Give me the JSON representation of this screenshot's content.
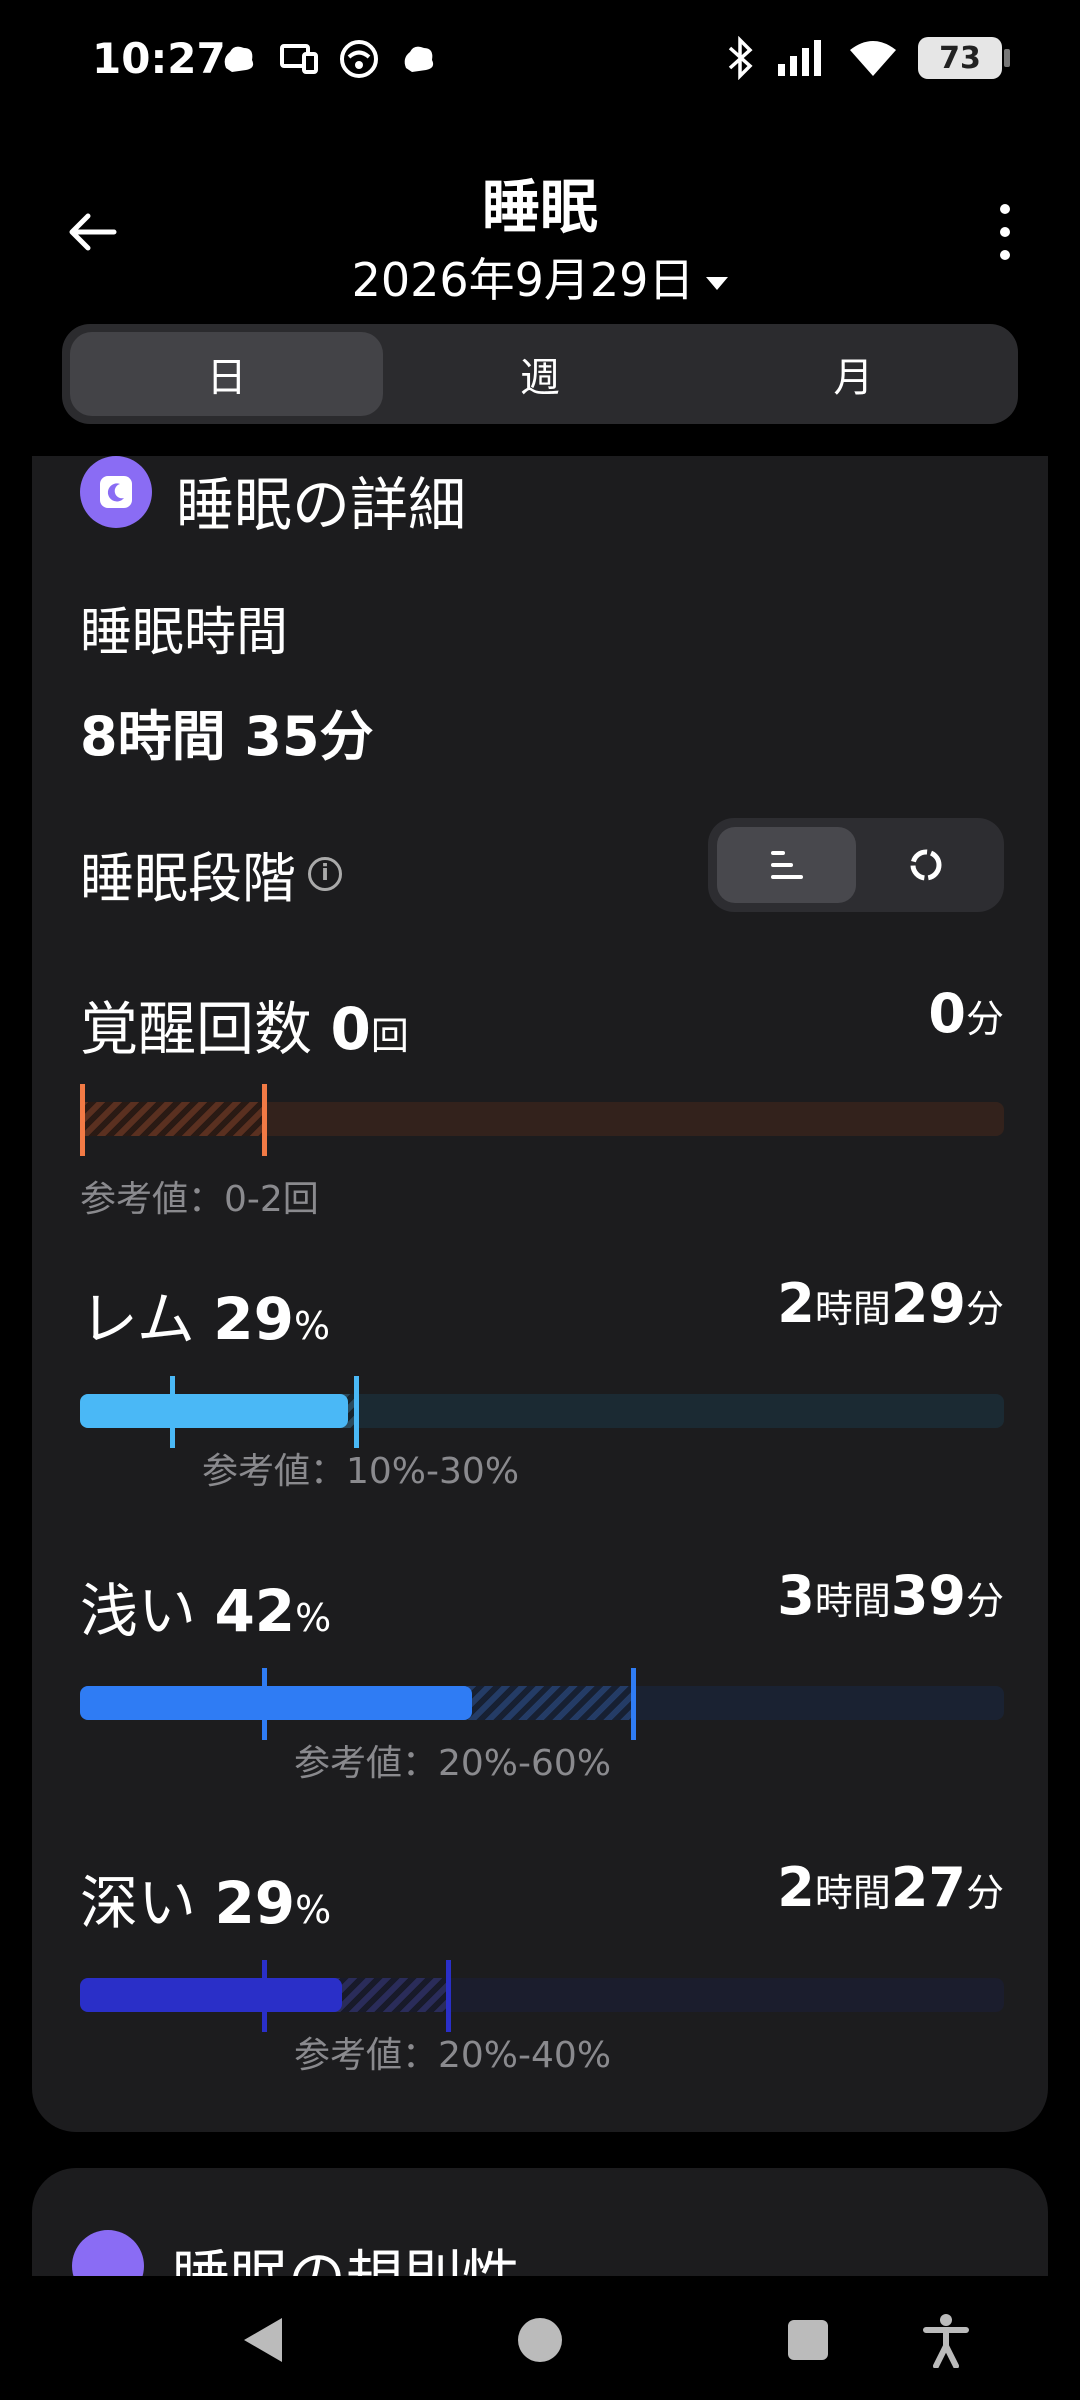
{
  "status_bar": {
    "time": "10:27",
    "battery": "73",
    "icons_left": [
      "notification-app-icon",
      "cast-icon",
      "hotspot-icon",
      "notification-app-icon"
    ],
    "icons_right": [
      "bluetooth-icon",
      "signal-icon",
      "wifi-icon",
      "battery-icon"
    ]
  },
  "header": {
    "title": "睡眠",
    "date": "2026年9月29日"
  },
  "tabs": [
    {
      "label": "日",
      "active": true
    },
    {
      "label": "週",
      "active": false
    },
    {
      "label": "月",
      "active": false
    }
  ],
  "detail": {
    "title": "睡眠の詳細",
    "sleep_time_label": "睡眠時間",
    "sleep_duration": "8時間 35分",
    "stages_label": "睡眠段階",
    "info_glyph": "i"
  },
  "stages": {
    "awake": {
      "name": "覚醒回数",
      "value": "0",
      "unit": "回",
      "time_value": "0",
      "time_unit": "分",
      "reference": "参考値：0-2回",
      "color": "#f27a45",
      "track_color": "#33221c"
    },
    "rem": {
      "name": "レム",
      "value": "29",
      "unit": "%",
      "hours": "2",
      "hours_unit": "時間",
      "minutes": "29",
      "minutes_unit": "分",
      "reference": "参考値：10%-30%",
      "percent": 29,
      "ref_min": 10,
      "ref_max": 30,
      "color": "#4ab8f6",
      "track_color": "#1b2a33"
    },
    "light": {
      "name": "浅い",
      "value": "42",
      "unit": "%",
      "hours": "3",
      "hours_unit": "時間",
      "minutes": "39",
      "minutes_unit": "分",
      "reference": "参考値：20%-60%",
      "percent": 42,
      "ref_min": 20,
      "ref_max": 60,
      "color": "#2f7cf4",
      "track_color": "#1a2232"
    },
    "deep": {
      "name": "深い",
      "value": "29",
      "unit": "%",
      "hours": "2",
      "hours_unit": "時間",
      "minutes": "27",
      "minutes_unit": "分",
      "reference": "参考値：20%-40%",
      "percent": 29,
      "ref_min": 20,
      "ref_max": 40,
      "color": "#2a2fc8",
      "track_color": "#1b1d2d"
    }
  },
  "regularity": {
    "title": "睡眠の規則性"
  }
}
